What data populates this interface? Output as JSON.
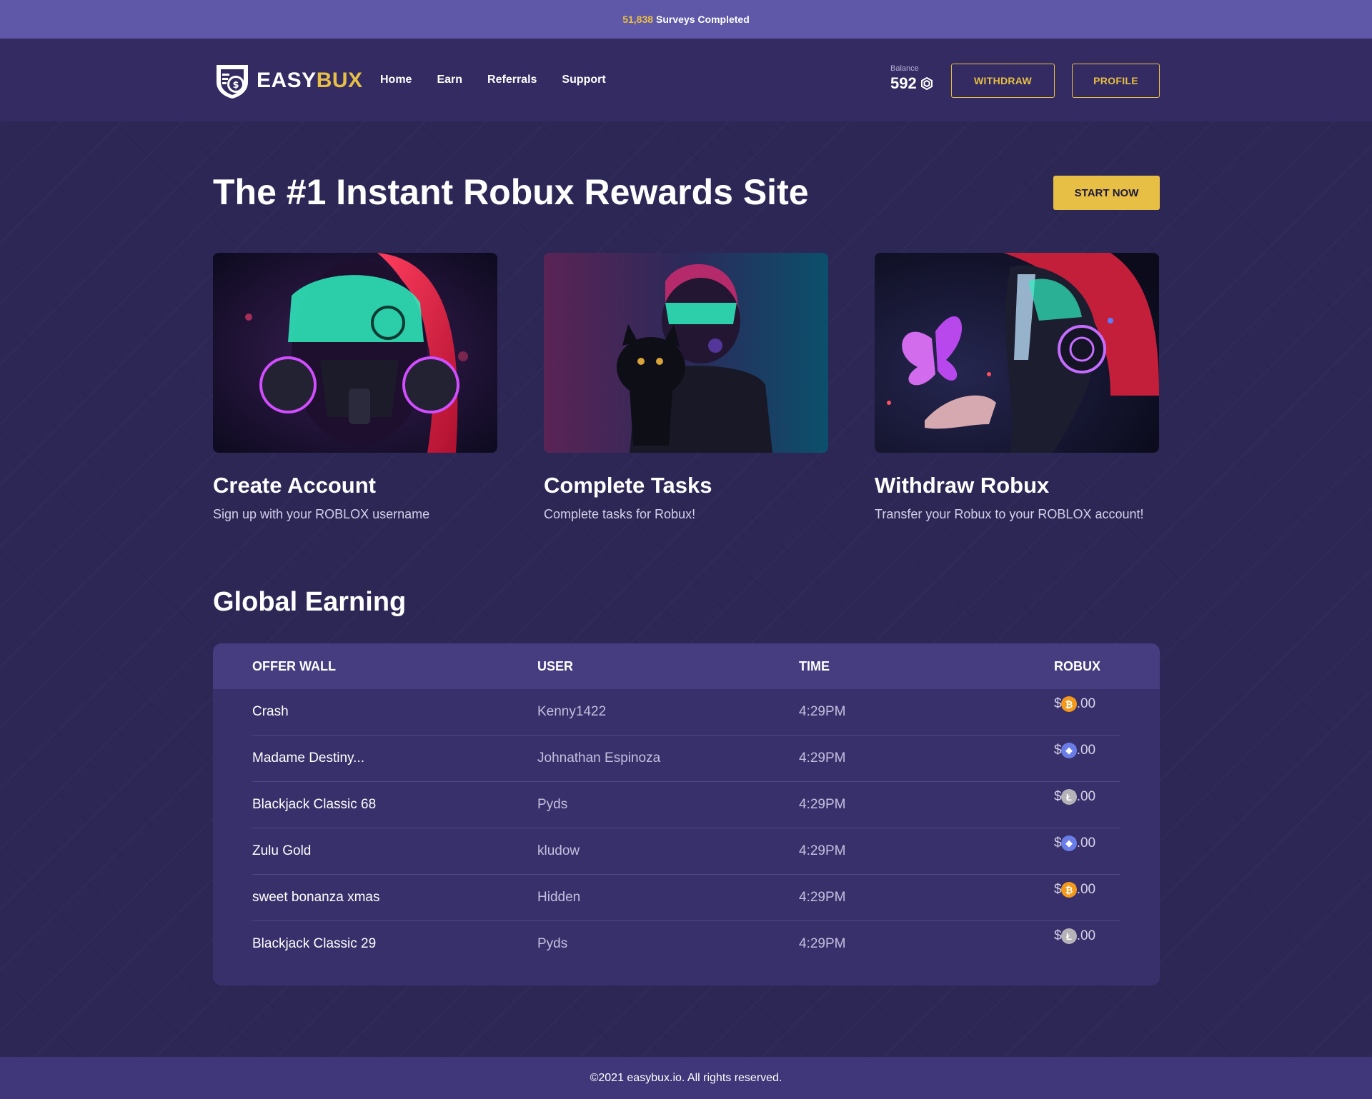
{
  "topbar": {
    "count": "51,838",
    "label": "Surveys Completed"
  },
  "brand": {
    "easy": "EASY",
    "bux": "BUX",
    "accent_color": "#e8bf45",
    "logo_icon": "money-bag-shield-icon"
  },
  "nav": {
    "items": [
      {
        "label": "Home"
      },
      {
        "label": "Earn"
      },
      {
        "label": "Referrals"
      },
      {
        "label": "Support"
      }
    ]
  },
  "balance": {
    "label": "Balance",
    "value": "592",
    "icon": "robux-icon"
  },
  "header_buttons": {
    "withdraw": "WITHDRAW",
    "profile": "PROFILE"
  },
  "hero": {
    "title": "The #1 Instant Robux Rewards Site",
    "cta": "START NOW"
  },
  "steps": [
    {
      "title": "Create Account",
      "description": "Sign up with your ROBLOX username",
      "image": "cyberpunk-gasmask-girl-portrait"
    },
    {
      "title": "Complete Tasks",
      "description": "Complete tasks for Robux!",
      "image": "cyberpunk-girl-with-black-cat"
    },
    {
      "title": "Withdraw Robux",
      "description": "Transfer your Robux to your ROBLOX account!",
      "image": "cyberpunk-girl-with-neon-butterfly"
    }
  ],
  "global_earning": {
    "title": "Global Earning",
    "columns": {
      "offer_wall": "OFFER WALL",
      "user": "USER",
      "time": "TIME",
      "robux": "ROBUX"
    },
    "rows": [
      {
        "offer": "Crash",
        "user": "Kenny1422",
        "time": "4:29PM",
        "amount": "$20.00",
        "coin": "bitcoin-icon"
      },
      {
        "offer": "Madame Destiny...",
        "user": "Johnathan Espinoza",
        "time": "4:29PM",
        "amount": "$20.00",
        "coin": "ethereum-icon"
      },
      {
        "offer": "Blackjack Classic 68",
        "user": "Pyds",
        "time": "4:29PM",
        "amount": "$20.00",
        "coin": "litecoin-icon"
      },
      {
        "offer": "Zulu Gold",
        "user": "kludow",
        "time": "4:29PM",
        "amount": "$20.00",
        "coin": "ethereum-icon"
      },
      {
        "offer": "sweet bonanza xmas",
        "user": "Hidden",
        "time": "4:29PM",
        "amount": "$20.00",
        "coin": "bitcoin-icon"
      },
      {
        "offer": "Blackjack Classic 29",
        "user": "Pyds",
        "time": "4:29PM",
        "amount": "$20.00",
        "coin": "litecoin-icon"
      }
    ]
  },
  "footer": {
    "text": "©2021 easybux.io. All rights reserved."
  }
}
